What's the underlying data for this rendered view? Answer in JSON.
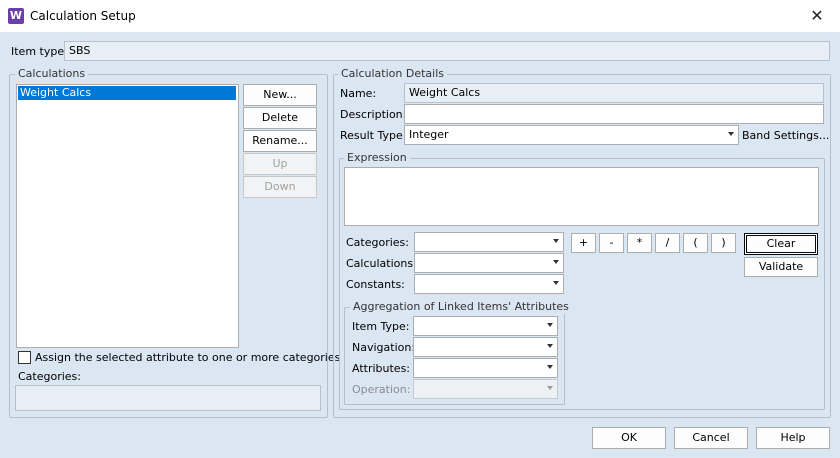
{
  "window": {
    "title": "Calculation Setup",
    "app_icon_letter": "W",
    "close_glyph": "✕"
  },
  "item_type": {
    "label": "Item type:",
    "value": "SBS"
  },
  "calculations": {
    "group_label": "Calculations",
    "items": [
      "Weight Calcs"
    ],
    "buttons": {
      "new": "New...",
      "delete": "Delete",
      "rename": "Rename...",
      "up": "Up",
      "down": "Down"
    },
    "assign_checkbox_label": "Assign the selected attribute to one or more categories",
    "categories_label": "Categories:"
  },
  "details": {
    "group_label": "Calculation Details",
    "name_label": "Name:",
    "name_value": "Weight Calcs",
    "description_label": "Description:",
    "description_value": "",
    "result_type_label": "Result Type:",
    "result_type_value": "Integer",
    "band_settings_link": "Band Settings..."
  },
  "expression": {
    "group_label": "Expression",
    "value": "",
    "categories_label": "Categories:",
    "calculations_label": "Calculations:",
    "constants_label": "Constants:",
    "operators": [
      "+",
      "-",
      "*",
      "/",
      "(",
      ")"
    ],
    "clear_button": "Clear",
    "validate_button": "Validate"
  },
  "aggregation": {
    "group_label": "Aggregation of Linked Items' Attributes",
    "item_type_label": "Item Type:",
    "navigation_label": "Navigation:",
    "attributes_label": "Attributes:",
    "operation_label": "Operation:"
  },
  "footer": {
    "ok": "OK",
    "cancel": "Cancel",
    "help": "Help"
  }
}
